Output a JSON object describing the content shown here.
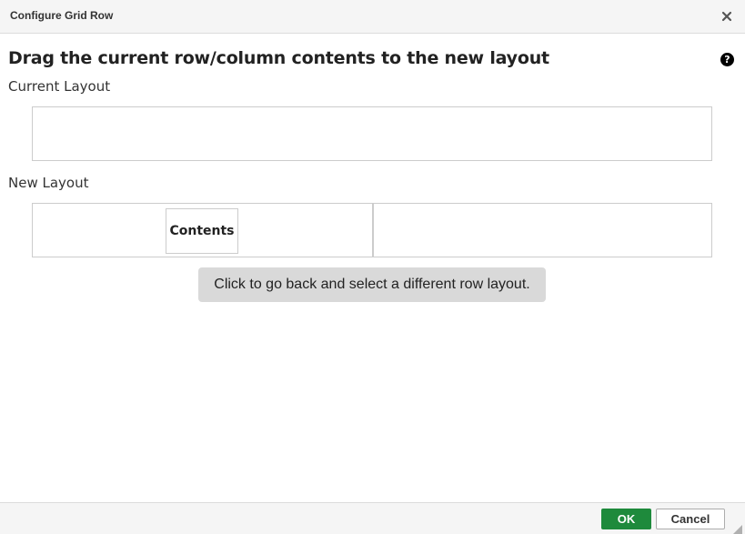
{
  "dialog": {
    "title": "Configure Grid Row",
    "close_icon": "close-icon",
    "help_icon": "help-icon",
    "help_glyph": "?"
  },
  "main": {
    "heading": "Drag the current row/column contents to the new layout",
    "current_layout_label": "Current Layout",
    "new_layout_label": "New Layout",
    "contents_chip": "Contents",
    "back_button": "Click to go back and select a different row layout."
  },
  "footer": {
    "ok_label": "OK",
    "cancel_label": "Cancel"
  },
  "colors": {
    "ok_background": "#1e8a3c",
    "back_button_background": "#d9d9d9",
    "titlebar_background": "#f5f5f5"
  }
}
